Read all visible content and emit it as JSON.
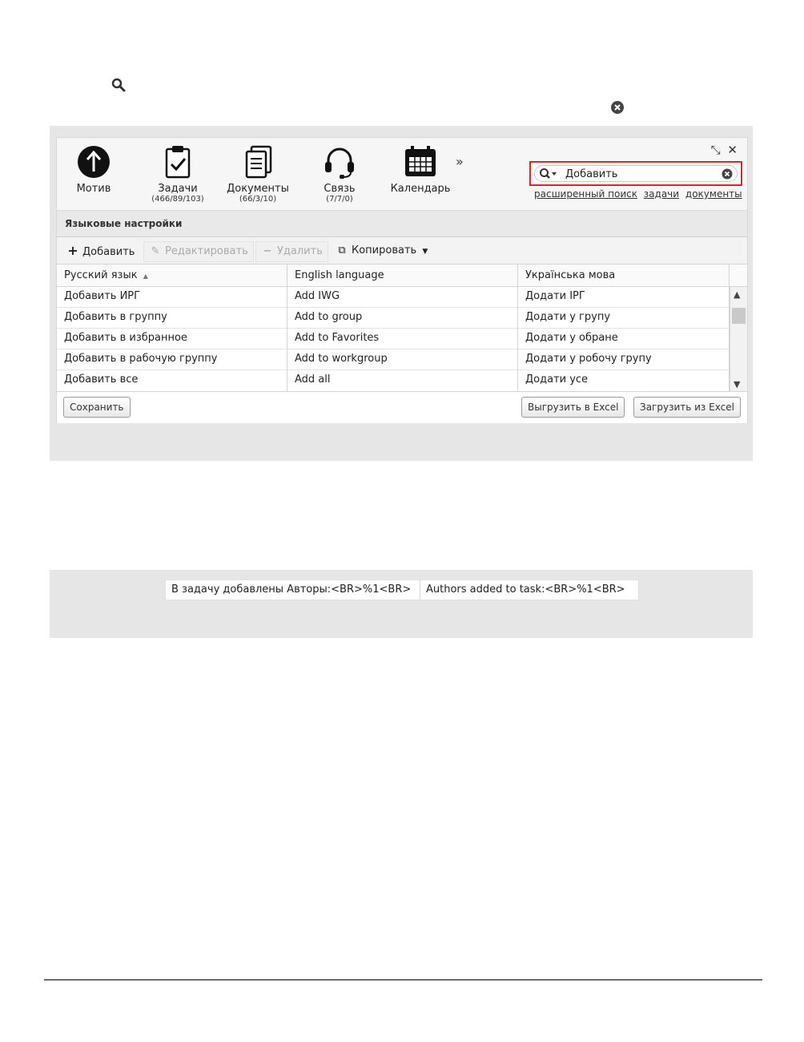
{
  "nav": {
    "items": [
      {
        "label": "Мотив",
        "counts": "",
        "icon": "arrow-up-circle-icon"
      },
      {
        "label": "Задачи",
        "counts": "(466/89/103)",
        "icon": "clipboard-check-icon"
      },
      {
        "label": "Документы",
        "counts": "(66/3/10)",
        "icon": "documents-icon"
      },
      {
        "label": "Связь",
        "counts": "(7/7/0)",
        "icon": "headset-icon"
      },
      {
        "label": "Календарь",
        "counts": "",
        "icon": "calendar-icon"
      }
    ],
    "more": "»"
  },
  "window_controls": {
    "restore": "⤡",
    "close": "✕"
  },
  "search": {
    "value": "Добавить",
    "highlight_color": "#d62828",
    "links": [
      "расширенный поиск",
      "задачи",
      "документы"
    ]
  },
  "section": {
    "title": "Языковые настройки"
  },
  "toolbar": {
    "add_label": "Добавить",
    "edit_label": "Редактировать",
    "delete_label": "Удалить",
    "copy_label": "Копировать"
  },
  "table": {
    "columns": [
      "Русский язык",
      "English language",
      "Українська мова"
    ],
    "rows": [
      [
        "Добавить ИРГ",
        "Add IWG",
        "Додати ІРГ"
      ],
      [
        "Добавить в группу",
        "Add to group",
        "Додати у групу"
      ],
      [
        "Добавить в избранное",
        "Add to Favorites",
        "Додати у обране"
      ],
      [
        "Добавить в рабочую группу",
        "Add to workgroup",
        "Додати у робочу групу"
      ],
      [
        "Добавить все",
        "Add all",
        "Додати усе"
      ]
    ]
  },
  "footer": {
    "save_label": "Сохранить",
    "export_label": "Выгрузить в Excel",
    "import_label": "Загрузить из Excel"
  },
  "second_screenshot": {
    "ru": "В задачу добавлены Авторы:<BR>%1<BR>",
    "en": "Authors added to task:<BR>%1<BR>"
  }
}
